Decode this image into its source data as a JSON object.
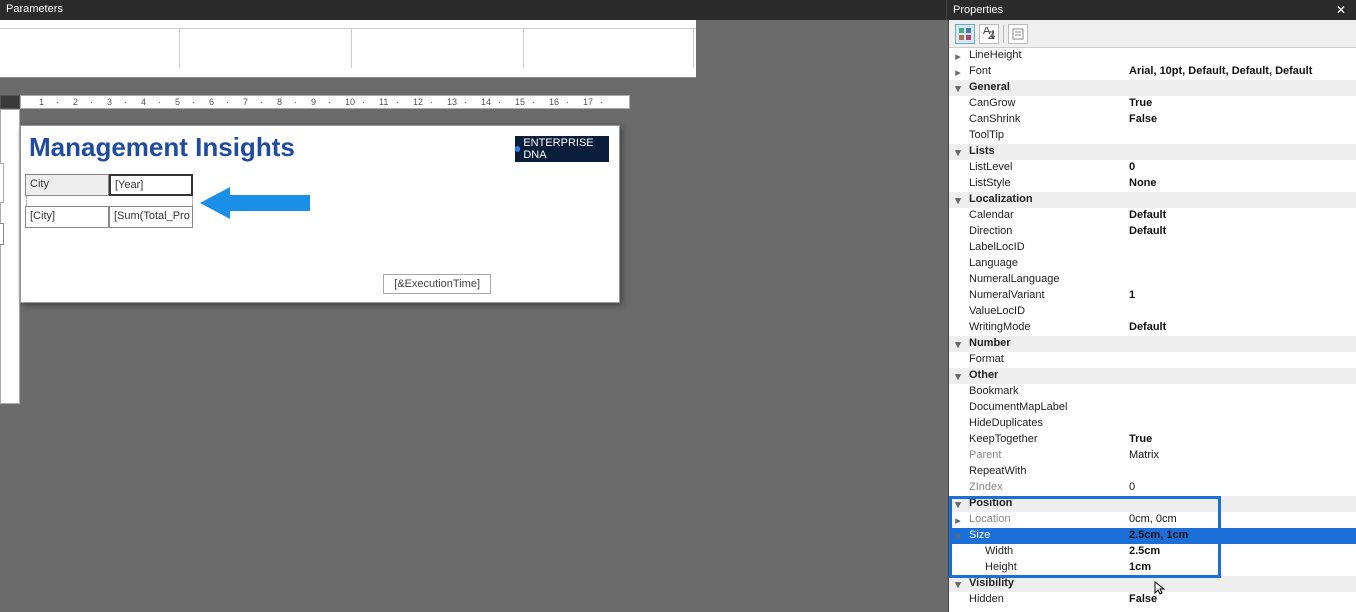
{
  "topbar": {
    "left": "Parameters",
    "right": "Properties",
    "close": "✕"
  },
  "ruler_ticks": [
    "1",
    "2",
    "3",
    "4",
    "5",
    "6",
    "7",
    "8",
    "9",
    "10",
    "11",
    "12",
    "13",
    "14",
    "15",
    "16",
    "17"
  ],
  "report": {
    "title": "Management Insights",
    "logo_text": "ENTERPRISE DNA",
    "matrix": {
      "r0c0": "City",
      "r0c1": "[Year]",
      "r1c0": "[City]",
      "r1c1": "[Sum(Total_Pro"
    },
    "exec_time": "[&ExecutionTime]"
  },
  "props_toolbar": {
    "cat": "categorized",
    "az": "alphabetical",
    "pages": "pages"
  },
  "properties": [
    {
      "type": "row",
      "exp": ">",
      "name": "LineHeight",
      "val": ""
    },
    {
      "type": "row",
      "exp": ">",
      "name": "Font",
      "val": "Arial, 10pt, Default, Default, Default",
      "bold": true
    },
    {
      "type": "cat",
      "exp": "v",
      "name": "General"
    },
    {
      "type": "row",
      "name": "CanGrow",
      "val": "True",
      "bold": true
    },
    {
      "type": "row",
      "name": "CanShrink",
      "val": "False",
      "bold": true
    },
    {
      "type": "row",
      "name": "ToolTip",
      "val": ""
    },
    {
      "type": "cat",
      "exp": "v",
      "name": "Lists"
    },
    {
      "type": "row",
      "name": "ListLevel",
      "val": "0",
      "bold": true
    },
    {
      "type": "row",
      "name": "ListStyle",
      "val": "None",
      "bold": true
    },
    {
      "type": "cat",
      "exp": "v",
      "name": "Localization"
    },
    {
      "type": "row",
      "name": "Calendar",
      "val": "Default",
      "bold": true
    },
    {
      "type": "row",
      "name": "Direction",
      "val": "Default",
      "bold": true
    },
    {
      "type": "row",
      "name": "LabelLocID",
      "val": ""
    },
    {
      "type": "row",
      "name": "Language",
      "val": ""
    },
    {
      "type": "row",
      "name": "NumeralLanguage",
      "val": ""
    },
    {
      "type": "row",
      "name": "NumeralVariant",
      "val": "1",
      "bold": true
    },
    {
      "type": "row",
      "name": "ValueLocID",
      "val": ""
    },
    {
      "type": "row",
      "name": "WritingMode",
      "val": "Default",
      "bold": true
    },
    {
      "type": "cat",
      "exp": "v",
      "name": "Number"
    },
    {
      "type": "row",
      "name": "Format",
      "val": ""
    },
    {
      "type": "cat",
      "exp": "v",
      "name": "Other"
    },
    {
      "type": "row",
      "name": "Bookmark",
      "val": ""
    },
    {
      "type": "row",
      "name": "DocumentMapLabel",
      "val": ""
    },
    {
      "type": "row",
      "name": "HideDuplicates",
      "val": ""
    },
    {
      "type": "row",
      "name": "KeepTogether",
      "val": "True",
      "bold": true
    },
    {
      "type": "row",
      "name": "Parent",
      "val": "Matrix",
      "grey": true
    },
    {
      "type": "row",
      "name": "RepeatWith",
      "val": ""
    },
    {
      "type": "row",
      "name": "ZIndex",
      "val": "0",
      "grey": true
    },
    {
      "type": "cat",
      "exp": "v",
      "name": "Position"
    },
    {
      "type": "row",
      "exp": ">",
      "name": "Location",
      "val": "0cm, 0cm",
      "grey": true
    },
    {
      "type": "row",
      "exp": "v",
      "name": "Size",
      "val": "2.5cm, 1cm",
      "bold": true,
      "sel": true
    },
    {
      "type": "row",
      "indent": true,
      "name": "Width",
      "val": "2.5cm",
      "bold": true
    },
    {
      "type": "row",
      "indent": true,
      "name": "Height",
      "val": "1cm",
      "bold": true
    },
    {
      "type": "cat",
      "exp": "v",
      "name": "Visibility"
    },
    {
      "type": "row",
      "name": "Hidden",
      "val": "False",
      "bold": true
    }
  ]
}
